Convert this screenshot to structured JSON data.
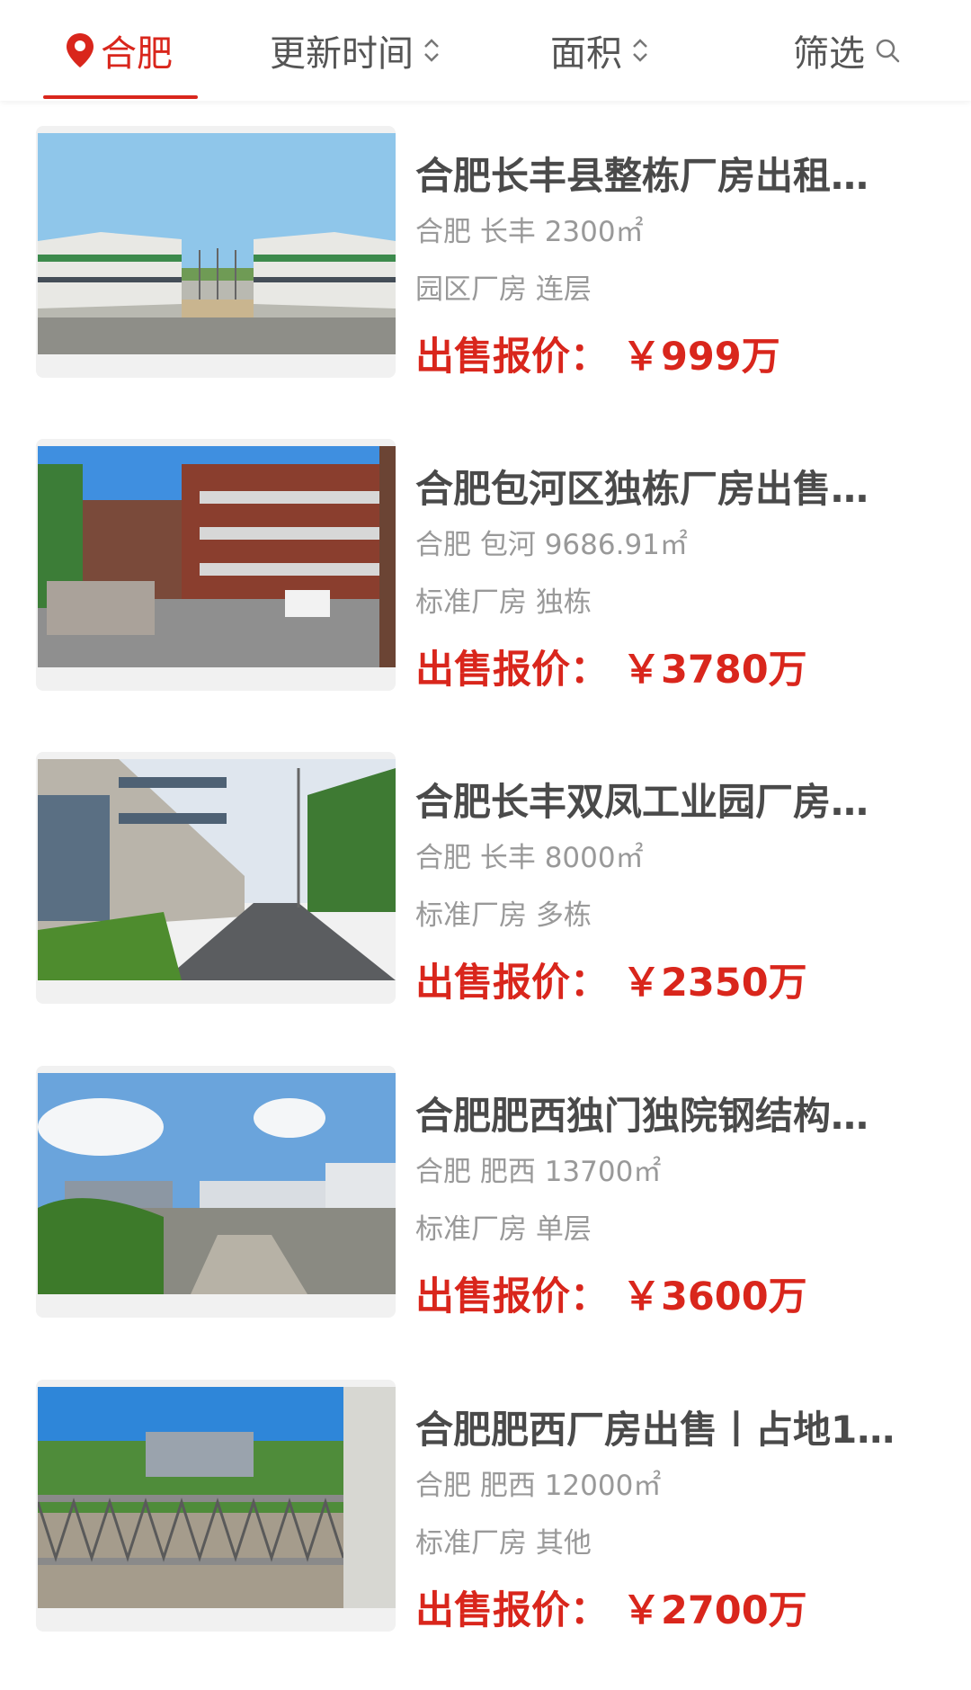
{
  "filter_bar": {
    "location_label": "合肥",
    "sort_updated_label": "更新时间",
    "sort_area_label": "面积",
    "filter_label": "筛选"
  },
  "listings": [
    {
      "title": "合肥长丰县整栋厂房出租…",
      "meta": "合肥 长丰 2300㎡",
      "tags": "园区厂房 连层",
      "price": "出售报价： ￥999万"
    },
    {
      "title": "合肥包河区独栋厂房出售…",
      "meta": "合肥 包河 9686.91㎡",
      "tags": "标准厂房 独栋",
      "price": "出售报价： ￥3780万"
    },
    {
      "title": "合肥长丰双凤工业园厂房…",
      "meta": "合肥 长丰 8000㎡",
      "tags": "标准厂房 多栋",
      "price": "出售报价： ￥2350万"
    },
    {
      "title": "合肥肥西独门独院钢结构…",
      "meta": "合肥 肥西 13700㎡",
      "tags": "标准厂房 单层",
      "price": "出售报价： ￥3600万"
    },
    {
      "title": "合肥肥西厂房出售丨占地1…",
      "meta": "合肥 肥西 12000㎡",
      "tags": "标准厂房 其他",
      "price": "出售报价： ￥2700万"
    }
  ],
  "colors": {
    "accent": "#d9261c",
    "title_text": "#4a4a4a",
    "secondary_text": "#999999"
  },
  "icons": {
    "location": "location-pin-icon",
    "sort": "sort-updown-icon",
    "search": "search-icon"
  }
}
